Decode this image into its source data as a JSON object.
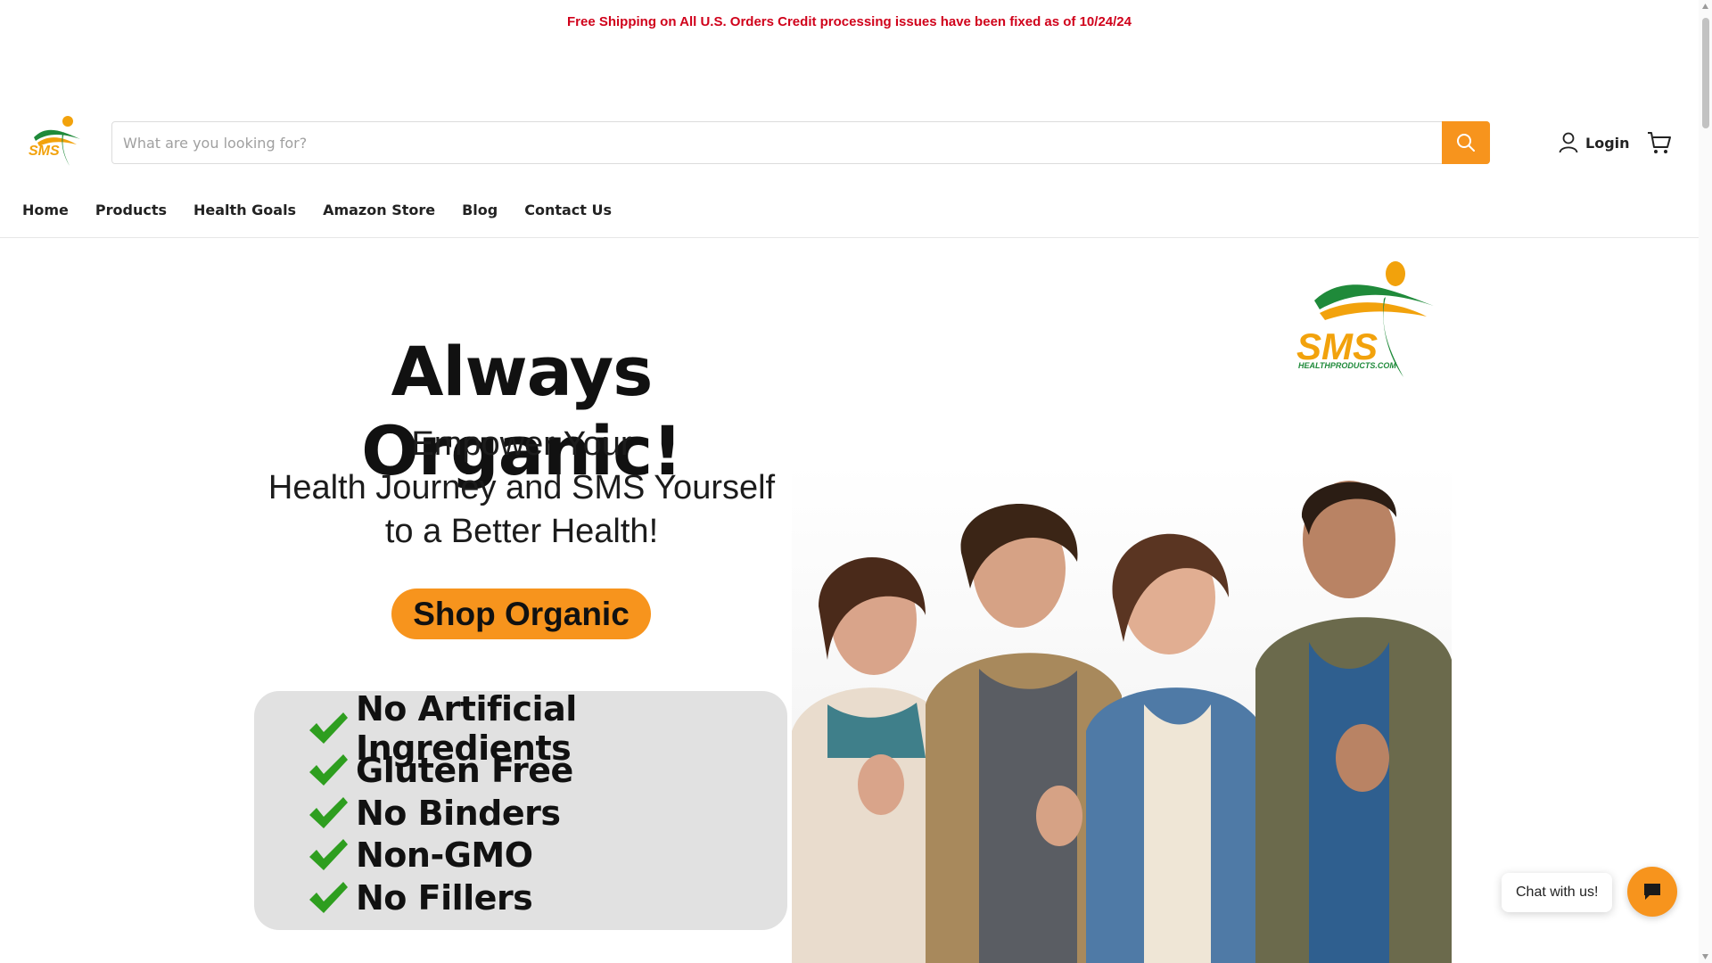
{
  "announcement": {
    "text": "Free Shipping on All U.S. Orders Credit processing issues have been fixed as of 10/24/24"
  },
  "header": {
    "logo_text": "SMS",
    "search": {
      "placeholder": "What are you looking for?",
      "value": ""
    },
    "login_label": "Login"
  },
  "nav": {
    "items": [
      {
        "label": "Home"
      },
      {
        "label": "Products"
      },
      {
        "label": "Health Goals"
      },
      {
        "label": "Amazon Store"
      },
      {
        "label": "Blog"
      },
      {
        "label": "Contact Us"
      }
    ]
  },
  "hero": {
    "title": "Always Organic!",
    "subtitle_lines": [
      "Empower Your",
      "Health Journey and SMS Yourself",
      "to a Better Health!"
    ],
    "cta_label": "Shop Organic",
    "features": [
      {
        "label": "No Artificial Ingredients"
      },
      {
        "label": "Gluten Free"
      },
      {
        "label": "No Binders"
      },
      {
        "label": "Non-GMO"
      },
      {
        "label": "No Fillers"
      }
    ],
    "brand_logo": {
      "text": "SMS",
      "subtext": "HEALTHPRODUCTS.COM"
    }
  },
  "chat": {
    "label": "Chat with us!"
  },
  "colors": {
    "accent": "#f7941d",
    "announcement": "#d0021b",
    "check": "#2e9e1f",
    "logo_green": "#1f8a3a",
    "logo_orange": "#f2a20c"
  }
}
